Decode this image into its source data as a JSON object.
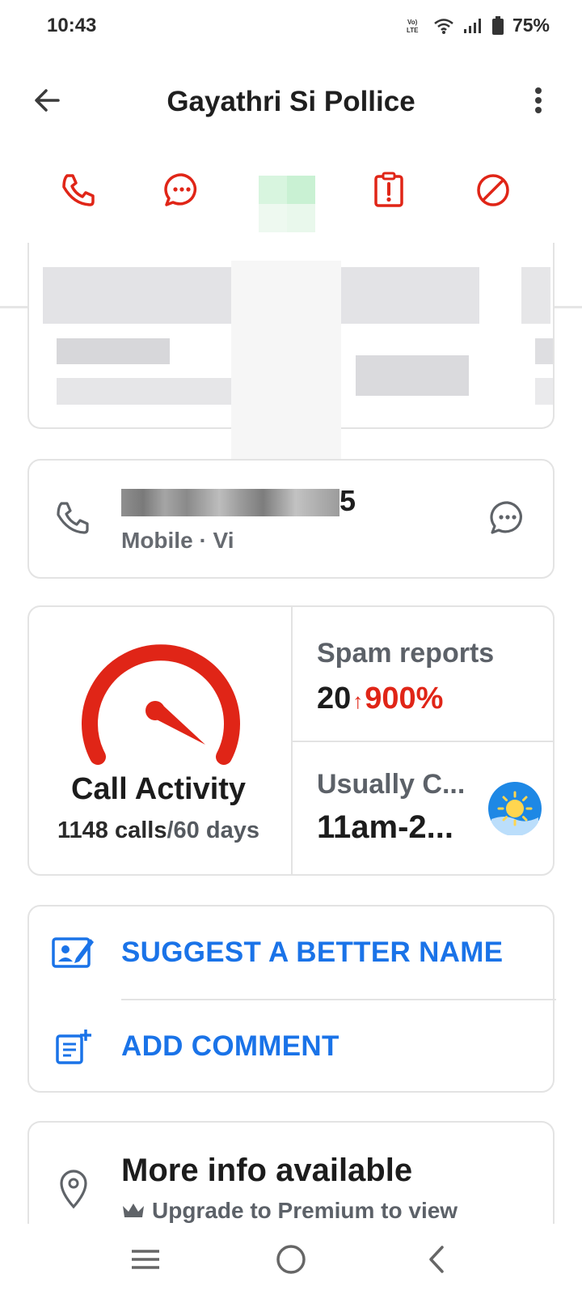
{
  "status_bar": {
    "time": "10:43",
    "battery": "75%",
    "icons": [
      "volte-icon",
      "wifi-icon",
      "signal-icon",
      "battery-icon"
    ]
  },
  "header": {
    "title": "Gayathri Si Pollice"
  },
  "actions": [
    {
      "name": "call-action",
      "icon": "phone-icon"
    },
    {
      "name": "message-action",
      "icon": "chat-bubble-icon"
    },
    {
      "name": "whatsapp-action",
      "icon": "redacted"
    },
    {
      "name": "report-action",
      "icon": "report-icon"
    },
    {
      "name": "block-action",
      "icon": "block-icon"
    }
  ],
  "phone": {
    "number_visible": "5",
    "type": "Mobile · Vi"
  },
  "activity": {
    "title": "Call Activity",
    "calls": "1148 calls",
    "period": "/60 days"
  },
  "spam": {
    "label": "Spam reports",
    "count": "20",
    "change": "900%"
  },
  "usual": {
    "label": "Usually C...",
    "value": "11am-2..."
  },
  "suggest": {
    "label": "SUGGEST A BETTER NAME"
  },
  "comment": {
    "label": "ADD COMMENT"
  },
  "more_info": {
    "title": "More info available",
    "subtitle": "Upgrade to Premium to view"
  },
  "colors": {
    "accent_red": "#e02517",
    "link_blue": "#1a73e8"
  }
}
